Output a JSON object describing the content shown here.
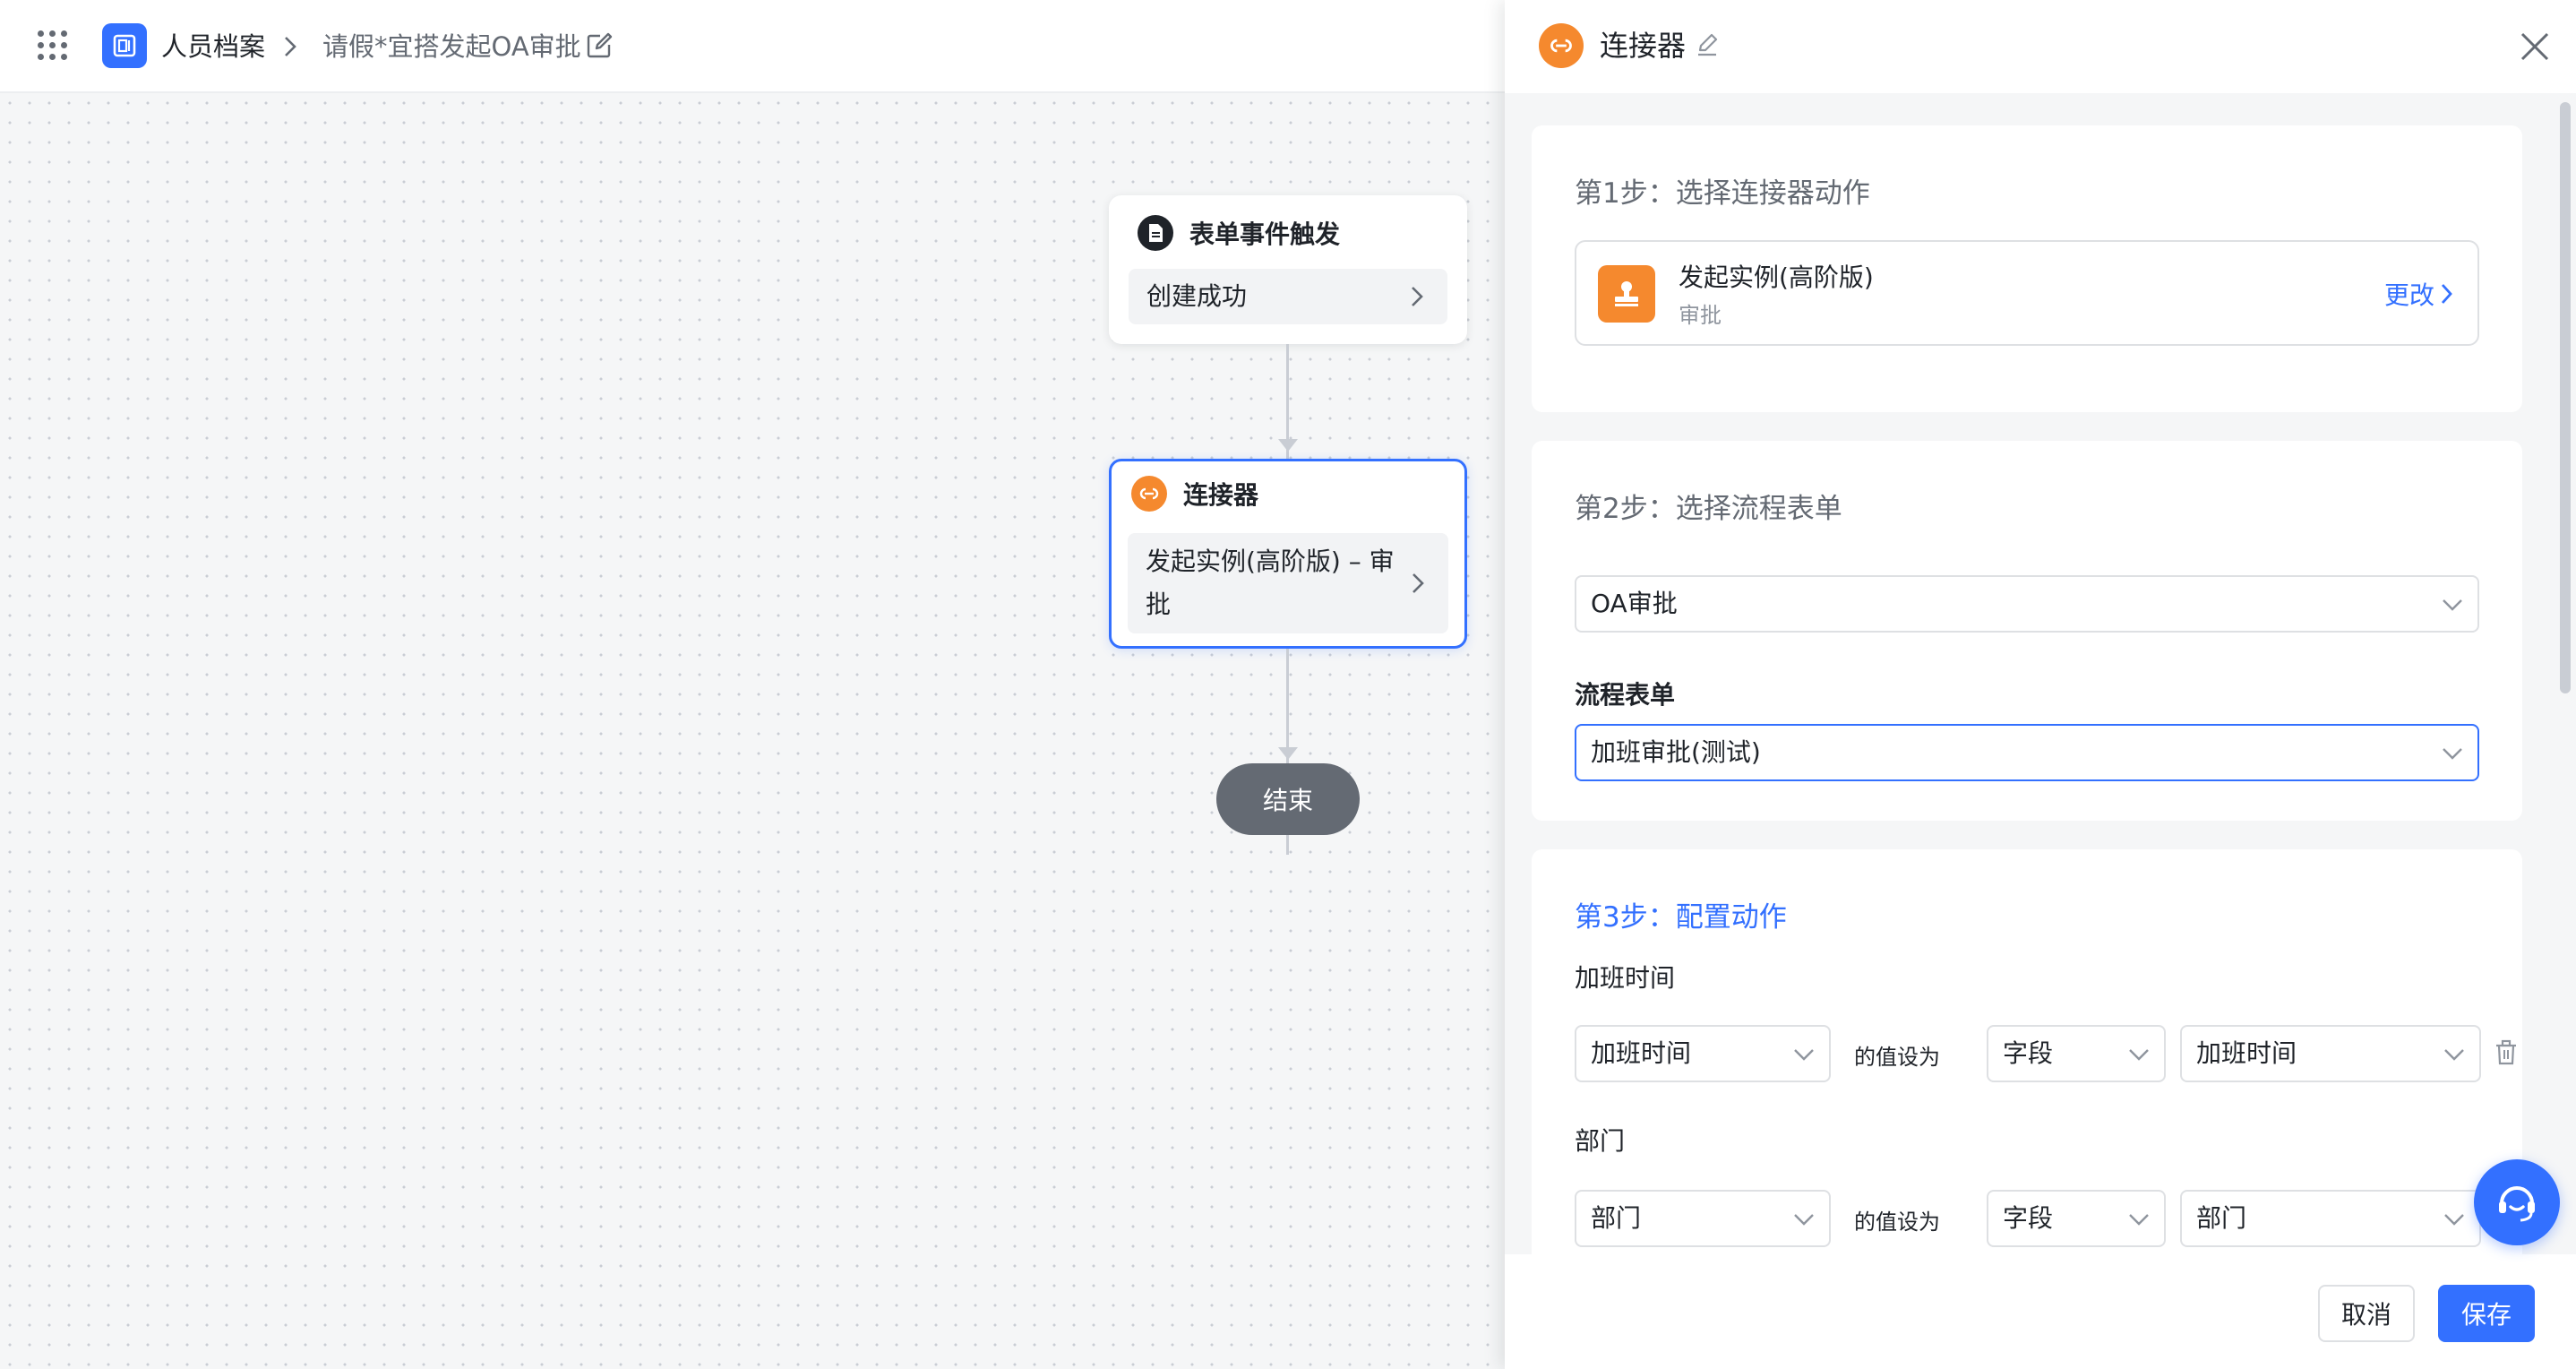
{
  "breadcrumb": {
    "app_name": "人员档案",
    "current": "请假*宜搭发起OA审批"
  },
  "canvas": {
    "trigger_node": {
      "title": "表单事件触发",
      "body": "创建成功"
    },
    "connector_node": {
      "title": "连接器",
      "body": "发起实例(高阶版) – 审批"
    },
    "end_node": {
      "label": "结束"
    }
  },
  "panel": {
    "title": "连接器",
    "step1": {
      "title": "第1步：选择连接器动作",
      "action_name": "发起实例(高阶版)",
      "action_sub": "审批",
      "change_label": "更改"
    },
    "step2": {
      "title": "第2步：选择流程表单",
      "app_select_value": "OA审批",
      "form_label": "流程表单",
      "form_select_value": "加班审批(测试)"
    },
    "step3": {
      "title": "第3步：配置动作",
      "rows": [
        {
          "label": "加班时间",
          "target_field": "加班时间",
          "value_set_label": "的值设为",
          "source_type": "字段",
          "source_value": "加班时间"
        },
        {
          "label": "部门",
          "target_field": "部门",
          "value_set_label": "的值设为",
          "source_type": "字段",
          "source_value": "部门"
        }
      ]
    },
    "footer": {
      "cancel_label": "取消",
      "save_label": "保存"
    }
  },
  "colors": {
    "primary": "#3370ff",
    "connector_orange": "#f5892e",
    "end_node_gray": "#646a73"
  },
  "icons": {
    "apps": "apps-grid-icon",
    "app_logo": "form-app-icon",
    "trigger": "form-doc-icon",
    "connector": "connector-link-icon",
    "action": "stamp-icon",
    "help": "customer-service-icon"
  }
}
